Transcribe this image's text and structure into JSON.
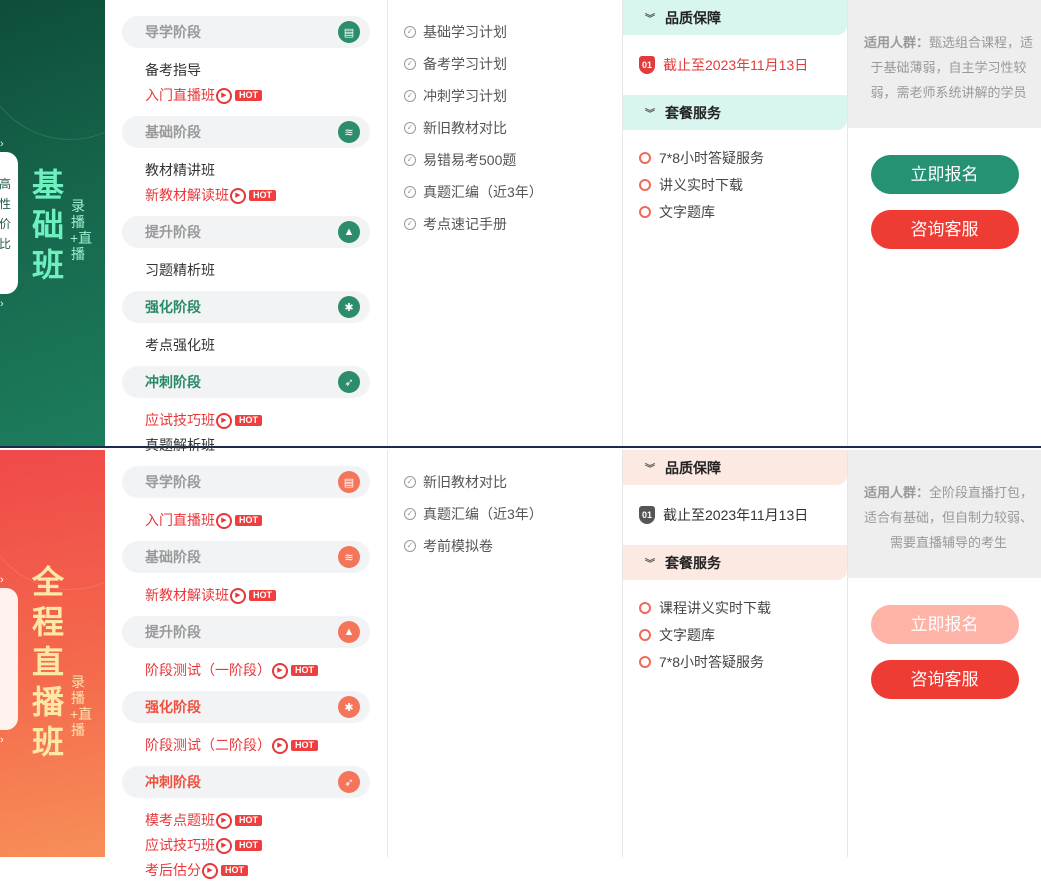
{
  "cards": [
    {
      "banner": {
        "title": "基础班",
        "sub": "录播+直播",
        "tab_text": "高性价比"
      },
      "stages": [
        {
          "label": "导学阶段",
          "icon": "doc-icon",
          "active": false,
          "courses": [
            {
              "name": "备考指导",
              "hot": false
            },
            {
              "name": "入门直播班",
              "hot": true
            }
          ]
        },
        {
          "label": "基础阶段",
          "icon": "layers-icon",
          "active": false,
          "courses": [
            {
              "name": "教材精讲班",
              "hot": false
            },
            {
              "name": "新教材解读班",
              "hot": true
            }
          ]
        },
        {
          "label": "提升阶段",
          "icon": "chart-icon",
          "active": false,
          "courses": [
            {
              "name": "习题精析班",
              "hot": false
            }
          ]
        },
        {
          "label": "强化阶段",
          "icon": "bulb-icon",
          "active": true,
          "courses": [
            {
              "name": "考点强化班",
              "hot": false
            }
          ]
        },
        {
          "label": "冲刺阶段",
          "icon": "rocket-icon",
          "active": true,
          "courses": [
            {
              "name": "应试技巧班",
              "hot": true
            },
            {
              "name": "真题解析班",
              "hot": false
            }
          ]
        }
      ],
      "materials": [
        "基础学习计划",
        "备考学习计划",
        "冲刺学习计划",
        "新旧教材对比",
        "易错易考500题",
        "真题汇编（近3年）",
        "考点速记手册"
      ],
      "quality_title": "品质保障",
      "shield_text": "01",
      "quality_text": "截止至2023年11月13日",
      "service_title": "套餐服务",
      "services": [
        "7*8小时答疑服务",
        "讲义实时下载",
        "文字题库"
      ],
      "audience_label": "适用人群：",
      "audience_text": "甄选组合课程，适于基础薄弱，自主学习性较弱，需老师系统讲解的学员",
      "enroll_label": "立即报名",
      "consult_label": "咨询客服"
    },
    {
      "banner": {
        "title": "全程直播班",
        "sub": "录播+直播",
        "tab_text": ""
      },
      "stages": [
        {
          "label": "导学阶段",
          "icon": "doc-icon",
          "active": false,
          "courses": [
            {
              "name": "入门直播班",
              "hot": true
            }
          ]
        },
        {
          "label": "基础阶段",
          "icon": "layers-icon",
          "active": false,
          "courses": [
            {
              "name": "新教材解读班",
              "hot": true
            }
          ]
        },
        {
          "label": "提升阶段",
          "icon": "chart-icon",
          "active": false,
          "courses": [
            {
              "name": "阶段测试（一阶段）",
              "hot": true
            }
          ]
        },
        {
          "label": "强化阶段",
          "icon": "bulb-icon",
          "active": true,
          "courses": [
            {
              "name": "阶段测试（二阶段）",
              "hot": true
            }
          ]
        },
        {
          "label": "冲刺阶段",
          "icon": "rocket-icon",
          "active": true,
          "courses": [
            {
              "name": "模考点题班",
              "hot": true
            },
            {
              "name": "应试技巧班",
              "hot": true
            },
            {
              "name": "考后估分",
              "hot": true
            }
          ]
        }
      ],
      "materials": [
        "新旧教材对比",
        "真题汇编（近3年）",
        "考前模拟卷"
      ],
      "quality_title": "品质保障",
      "shield_text": "01",
      "quality_text": "截止至2023年11月13日",
      "service_title": "套餐服务",
      "services": [
        "课程讲义实时下载",
        "文字题库",
        "7*8小时答疑服务"
      ],
      "audience_label": "适用人群：",
      "audience_text": "全阶段直播打包，适合有基础，但自制力较弱、需要直播辅导的考生",
      "enroll_label": "立即报名",
      "consult_label": "咨询客服"
    }
  ],
  "hot_label": "HOT",
  "icons": {
    "check": "check-circle-icon",
    "service": "ring-icon",
    "play": "play-icon",
    "expand": "double-chevron-down-icon"
  }
}
